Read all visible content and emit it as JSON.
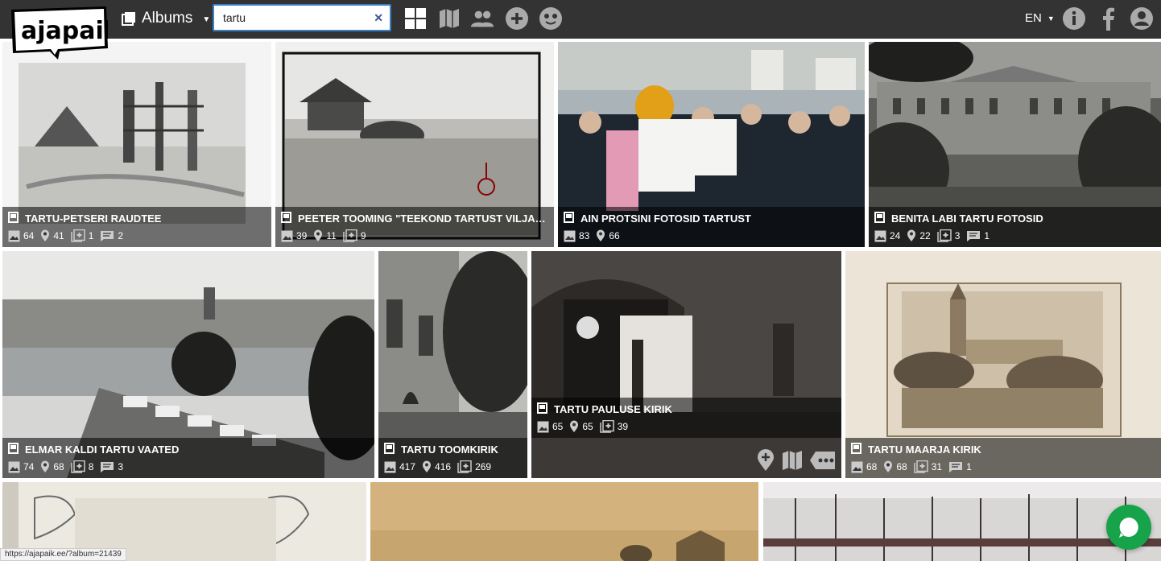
{
  "header": {
    "logo_text": "ajapaik",
    "albums_label": "Albums",
    "search_value": "tartu",
    "language": "EN",
    "nav_icons": [
      "grid-view-icon",
      "map-icon",
      "people-icon",
      "add-icon",
      "smiley-icon"
    ],
    "right_icons": [
      "info-icon",
      "facebook-icon",
      "user-icon"
    ]
  },
  "albums": [
    {
      "title": "TARTU-PETSERI RAUDTEE",
      "photos": "64",
      "geotagged": "41",
      "rephotos": "1",
      "comments": "2"
    },
    {
      "title": "PEETER TOOMING \"TEEKOND TARTUST VILJAN...",
      "photos": "39",
      "geotagged": "11",
      "rephotos": "9",
      "comments": null
    },
    {
      "title": "AIN PROTSINI FOTOSID TARTUST",
      "photos": "83",
      "geotagged": "66",
      "rephotos": null,
      "comments": null
    },
    {
      "title": "BENITA LABI TARTU FOTOSID",
      "photos": "24",
      "geotagged": "22",
      "rephotos": "3",
      "comments": "1"
    },
    {
      "title": "ELMAR KALDI TARTU VAATED",
      "photos": "74",
      "geotagged": "68",
      "rephotos": "8",
      "comments": "3"
    },
    {
      "title": "TARTU TOOMKIRIK",
      "photos": "417",
      "geotagged": "416",
      "rephotos": "269",
      "comments": null
    },
    {
      "title": "TARTU PAULUSE KIRIK",
      "photos": "65",
      "geotagged": "65",
      "rephotos": "39",
      "comments": null
    },
    {
      "title": "TARTU MAARJA KIRIK",
      "photos": "68",
      "geotagged": "68",
      "rephotos": "31",
      "comments": "1"
    }
  ],
  "status_url": "https://ajapaik.ee/?album=21439",
  "colors": {
    "topbar": "#333333",
    "search_border": "#3b7fc4",
    "chat": "#16a34a"
  }
}
